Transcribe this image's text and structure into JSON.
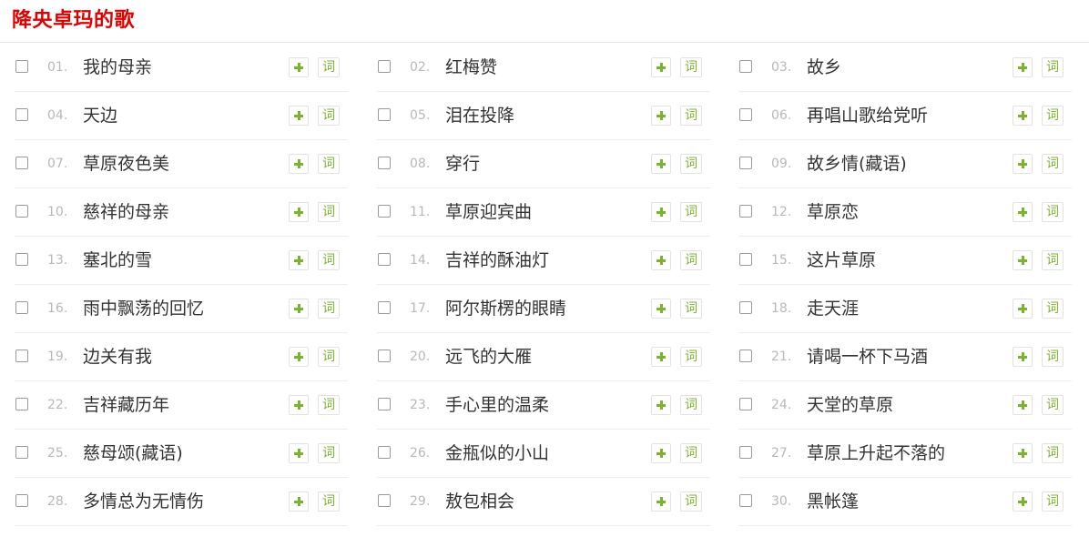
{
  "page": {
    "title": "降央卓玛的歌"
  },
  "actions": {
    "add_icon": "plus-icon",
    "lyric_label": "词"
  },
  "colors": {
    "title": "#e00000",
    "accent": "#7ab32e",
    "number": "#b8b8b8",
    "text": "#333333"
  },
  "columns": [
    {
      "songs": [
        {
          "num": "01.",
          "name": "我的母亲"
        },
        {
          "num": "04.",
          "name": "天边"
        },
        {
          "num": "07.",
          "name": "草原夜色美"
        },
        {
          "num": "10.",
          "name": "慈祥的母亲"
        },
        {
          "num": "13.",
          "name": "塞北的雪"
        },
        {
          "num": "16.",
          "name": "雨中飘荡的回忆"
        },
        {
          "num": "19.",
          "name": "边关有我"
        },
        {
          "num": "22.",
          "name": "吉祥藏历年"
        },
        {
          "num": "25.",
          "name": "慈母颂(藏语)"
        },
        {
          "num": "28.",
          "name": "多情总为无情伤"
        }
      ]
    },
    {
      "songs": [
        {
          "num": "02.",
          "name": "红梅赞"
        },
        {
          "num": "05.",
          "name": "泪在投降"
        },
        {
          "num": "08.",
          "name": "穿行"
        },
        {
          "num": "11.",
          "name": "草原迎宾曲"
        },
        {
          "num": "14.",
          "name": "吉祥的酥油灯"
        },
        {
          "num": "17.",
          "name": "阿尔斯楞的眼睛"
        },
        {
          "num": "20.",
          "name": "远飞的大雁"
        },
        {
          "num": "23.",
          "name": "手心里的温柔"
        },
        {
          "num": "26.",
          "name": "金瓶似的小山"
        },
        {
          "num": "29.",
          "name": "敖包相会"
        }
      ]
    },
    {
      "songs": [
        {
          "num": "03.",
          "name": "故乡"
        },
        {
          "num": "06.",
          "name": "再唱山歌给党听"
        },
        {
          "num": "09.",
          "name": "故乡情(藏语)"
        },
        {
          "num": "12.",
          "name": "草原恋"
        },
        {
          "num": "15.",
          "name": "这片草原"
        },
        {
          "num": "18.",
          "name": "走天涯"
        },
        {
          "num": "21.",
          "name": "请喝一杯下马酒"
        },
        {
          "num": "24.",
          "name": "天堂的草原"
        },
        {
          "num": "27.",
          "name": "草原上升起不落的"
        },
        {
          "num": "30.",
          "name": "黑帐篷"
        }
      ]
    }
  ]
}
